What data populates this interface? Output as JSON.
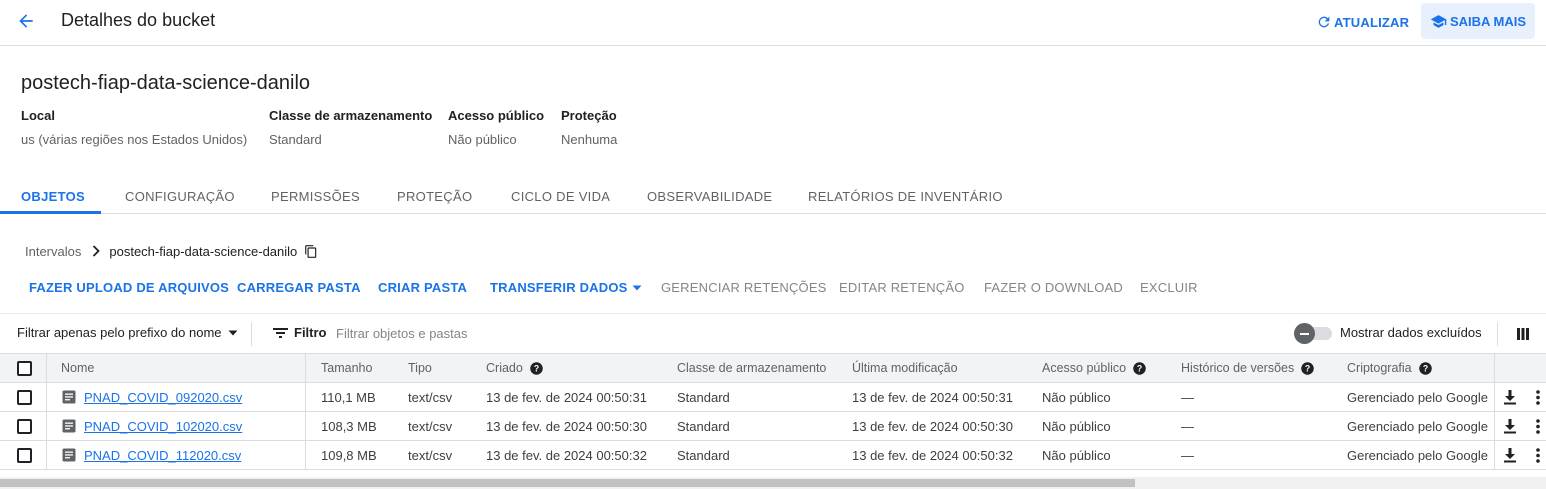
{
  "topbar": {
    "title": "Detalhes do bucket",
    "refresh_label": "ATUALIZAR",
    "learn_label": "SAIBA MAIS"
  },
  "bucket": {
    "name": "postech-fiap-data-science-danilo",
    "meta": [
      {
        "label": "Local",
        "value": "us (várias regiões nos Estados Unidos)"
      },
      {
        "label": "Classe de armazenamento",
        "value": "Standard"
      },
      {
        "label": "Acesso público",
        "value": "Não público"
      },
      {
        "label": "Proteção",
        "value": "Nenhuma"
      }
    ]
  },
  "tabs": [
    {
      "label": "OBJETOS",
      "active": true
    },
    {
      "label": "CONFIGURAÇÃO"
    },
    {
      "label": "PERMISSÕES"
    },
    {
      "label": "PROTEÇÃO"
    },
    {
      "label": "CICLO DE VIDA"
    },
    {
      "label": "OBSERVABILIDADE"
    },
    {
      "label": "RELATÓRIOS DE INVENTÁRIO"
    }
  ],
  "breadcrumb": {
    "root": "Intervalos",
    "current": "postech-fiap-data-science-danilo"
  },
  "actions": [
    {
      "label": "FAZER UPLOAD DE ARQUIVOS",
      "enabled": true
    },
    {
      "label": "CARREGAR PASTA",
      "enabled": true
    },
    {
      "label": "CRIAR PASTA",
      "enabled": true
    },
    {
      "label": "TRANSFERIR DADOS",
      "enabled": true
    },
    {
      "label": "GERENCIAR RETENÇÕES",
      "enabled": false
    },
    {
      "label": "EDITAR RETENÇÃO",
      "enabled": false
    },
    {
      "label": "FAZER O DOWNLOAD",
      "enabled": false
    },
    {
      "label": "EXCLUIR",
      "enabled": false
    }
  ],
  "filter": {
    "prefix_label": "Filtrar apenas pelo prefixo do nome",
    "filter_label": "Filtro",
    "placeholder": "Filtrar objetos e pastas",
    "show_deleted_label": "Mostrar dados excluídos"
  },
  "table": {
    "columns": [
      "Nome",
      "Tamanho",
      "Tipo",
      "Criado",
      "Classe de armazenamento",
      "Última modificação",
      "Acesso público",
      "Histórico de versões",
      "Criptografia"
    ],
    "rows": [
      [
        "PNAD_COVID_092020.csv",
        "110,1 MB",
        "text/csv",
        "13 de fev. de 2024 00:50:31",
        "Standard",
        "13 de fev. de 2024 00:50:31",
        "Não público",
        "—",
        "Gerenciado pelo Google"
      ],
      [
        "PNAD_COVID_102020.csv",
        "108,3 MB",
        "text/csv",
        "13 de fev. de 2024 00:50:30",
        "Standard",
        "13 de fev. de 2024 00:50:30",
        "Não público",
        "—",
        "Gerenciado pelo Google"
      ],
      [
        "PNAD_COVID_112020.csv",
        "109,8 MB",
        "text/csv",
        "13 de fev. de 2024 00:50:32",
        "Standard",
        "13 de fev. de 2024 00:50:32",
        "Não público",
        "—",
        "Gerenciado pelo Google"
      ]
    ]
  },
  "colors": {
    "accent": "#1a73e8",
    "disabled": "#80868b"
  },
  "icons": [
    "arrow-back-icon",
    "refresh-icon",
    "school-icon",
    "chevron-right-icon",
    "copy-icon",
    "dropdown-arrow-icon",
    "filter-icon",
    "columns-icon",
    "help-icon",
    "file-icon",
    "download-icon",
    "more-vert-icon"
  ]
}
